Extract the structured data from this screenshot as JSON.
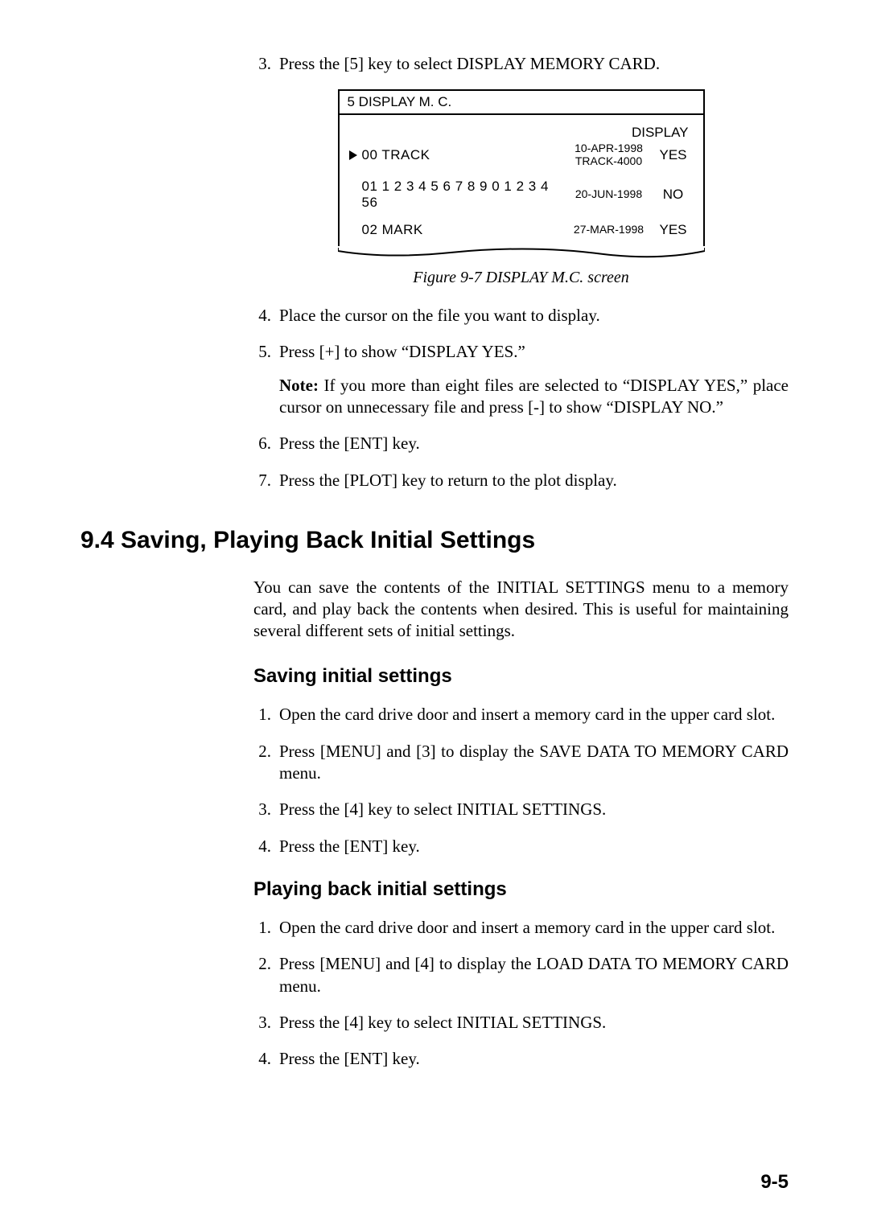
{
  "top_steps": {
    "s3": {
      "num": "3.",
      "text": "Press the [5] key to select DISPLAY MEMORY CARD."
    }
  },
  "figure": {
    "header": "5 DISPLAY M. C.",
    "display_hdr": "DISPLAY",
    "rows": [
      {
        "ptr": true,
        "label": "00  TRACK",
        "date": "10-APR-1998\nTRACK-4000",
        "yn": "YES"
      },
      {
        "ptr": false,
        "label": "01  1 2 3 4 5 6 7 8 9 0 1 2 3 4 56",
        "date": "20-JUN-1998",
        "yn": "NO"
      },
      {
        "ptr": false,
        "label": "02  MARK",
        "date": "27-MAR-1998",
        "yn": "YES"
      }
    ],
    "caption": "Figure 9-7 DISPLAY M.C. screen"
  },
  "mid_steps": {
    "s4": {
      "num": "4.",
      "text": "Place the cursor on the file you want to display."
    },
    "s5": {
      "num": "5.",
      "text": "Press [+] to show “DISPLAY YES.”",
      "note_label": "Note:",
      "note_text": " If you more than eight files are selected to “DISPLAY YES,” place cursor on unnecessary file and press [-] to show “DISPLAY NO.”"
    },
    "s6": {
      "num": "6.",
      "text": "Press the [ENT] key."
    },
    "s7": {
      "num": "7.",
      "text": "Press the [PLOT] key to return to the plot display."
    }
  },
  "section": {
    "heading": "9.4 Saving, Playing Back Initial Settings",
    "intro": "You can save the contents of the INITIAL SETTINGS menu to a memory card, and play back the contents when desired. This is useful for maintaining several different sets of initial settings."
  },
  "saving": {
    "heading": "Saving initial settings",
    "s1": {
      "num": "1.",
      "text": "Open the card drive door and insert a memory card in the upper card slot."
    },
    "s2": {
      "num": "2.",
      "text": "Press [MENU] and [3] to display the SAVE DATA TO MEMORY CARD menu."
    },
    "s3": {
      "num": "3.",
      "text": "Press the [4] key to select INITIAL SETTINGS."
    },
    "s4": {
      "num": "4.",
      "text": "Press the [ENT] key."
    }
  },
  "playing": {
    "heading": "Playing back initial settings",
    "s1": {
      "num": "1.",
      "text": "Open the card drive door and insert a memory card in the upper card slot."
    },
    "s2": {
      "num": "2.",
      "text": "Press [MENU] and [4] to display the LOAD DATA TO MEMORY CARD menu."
    },
    "s3": {
      "num": "3.",
      "text": "Press the [4] key to select INITIAL SETTINGS."
    },
    "s4": {
      "num": "4.",
      "text": "Press the [ENT] key."
    }
  },
  "page_num": "9-5"
}
